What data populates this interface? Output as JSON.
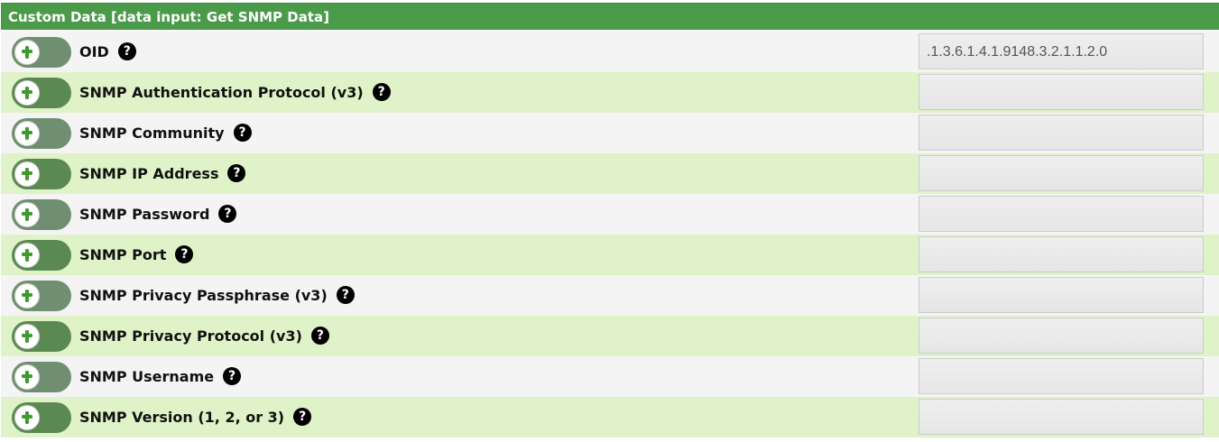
{
  "header": {
    "title": "Custom Data [data input: Get SNMP Data]"
  },
  "colors": {
    "header_bg": "#4a9a4a",
    "row_odd": "#f4f4f4",
    "row_even": "#e0f3c8",
    "toggle_bg": "#5b8a5b"
  },
  "rows": [
    {
      "label": "OID",
      "value": ".1.3.6.1.4.1.9148.3.2.1.1.2.0",
      "toggle_icon": "plus-icon",
      "help_icon": "question-circle-icon"
    },
    {
      "label": "SNMP Authentication Protocol (v3)",
      "value": "",
      "toggle_icon": "plus-icon",
      "help_icon": "question-circle-icon"
    },
    {
      "label": "SNMP Community",
      "value": "",
      "toggle_icon": "plus-icon",
      "help_icon": "question-circle-icon"
    },
    {
      "label": "SNMP IP Address",
      "value": "",
      "toggle_icon": "plus-icon",
      "help_icon": "question-circle-icon"
    },
    {
      "label": "SNMP Password",
      "value": "",
      "toggle_icon": "plus-icon",
      "help_icon": "question-circle-icon"
    },
    {
      "label": "SNMP Port",
      "value": "",
      "toggle_icon": "plus-icon",
      "help_icon": "question-circle-icon"
    },
    {
      "label": "SNMP Privacy Passphrase (v3)",
      "value": "",
      "toggle_icon": "plus-icon",
      "help_icon": "question-circle-icon"
    },
    {
      "label": "SNMP Privacy Protocol (v3)",
      "value": "",
      "toggle_icon": "plus-icon",
      "help_icon": "question-circle-icon"
    },
    {
      "label": "SNMP Username",
      "value": "",
      "toggle_icon": "plus-icon",
      "help_icon": "question-circle-icon"
    },
    {
      "label": "SNMP Version (1, 2, or 3)",
      "value": "",
      "toggle_icon": "plus-icon",
      "help_icon": "question-circle-icon"
    }
  ]
}
